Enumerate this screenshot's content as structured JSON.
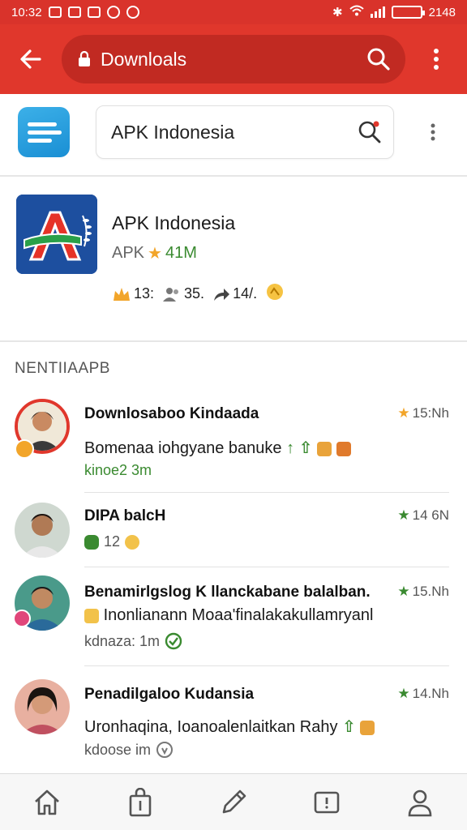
{
  "status_bar": {
    "time": "10:32",
    "right_text": "2148"
  },
  "toolbar": {
    "url_text": "Downloals"
  },
  "search": {
    "query": "APK Indonesia"
  },
  "app": {
    "name": "APK Indonesia",
    "category": "APK",
    "rating_text": "41M",
    "stats": [
      {
        "icon": "star-icon",
        "value": "13:"
      },
      {
        "icon": "users-icon",
        "value": "35."
      },
      {
        "icon": "share-icon",
        "value": "14/."
      }
    ]
  },
  "section": {
    "title": "NENTIIAAPB"
  },
  "feed": [
    {
      "title": "Downlosaboo Kindaada",
      "time": "15:Nh",
      "text": "Bomenaa iohgyane banuke",
      "meta": "kinoe2 3m"
    },
    {
      "title": "DIPA balcH",
      "time": "14 6N",
      "meta": "12"
    },
    {
      "title": "Benamirlgslog K llanckabane balalban.",
      "time": "15.Nh",
      "text": "Inonlianann Moaa'finalakakullamryanl",
      "meta": "kdnaza: 1m"
    },
    {
      "title": "Penadilgaloo Kudansia",
      "time": "14.Nh",
      "text": "Uronhaqina, Ioanoalenlaitkan Rahy",
      "meta": "kdoose im"
    }
  ],
  "colors": {
    "primary_red": "#e0372c",
    "dark_red": "#c12a22",
    "green": "#3a8a30",
    "gold": "#f2a52a"
  }
}
